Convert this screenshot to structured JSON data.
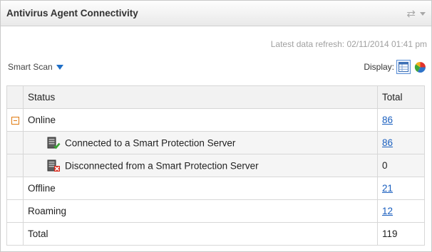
{
  "widget": {
    "title": "Antivirus Agent Connectivity",
    "refresh_text": "Latest data refresh: 02/11/2014 01:41 pm",
    "scan_select": "Smart Scan",
    "display_label": "Display:",
    "icons": {
      "refresh": "refresh-icon",
      "menu": "chevron-down-icon",
      "table_view": "table-icon",
      "chart_view": "pie-chart-icon",
      "connected": "server-connected-icon",
      "disconnected": "server-disconnected-icon"
    }
  },
  "table": {
    "headers": {
      "status": "Status",
      "total": "Total"
    },
    "rows": [
      {
        "status": "Online",
        "total": "86",
        "link": true
      },
      {
        "status": "Connected to a Smart Protection Server",
        "total": "86",
        "link": true
      },
      {
        "status": "Disconnected from a Smart Protection Server",
        "total": "0",
        "link": false
      },
      {
        "status": "Offline",
        "total": "21",
        "link": true
      },
      {
        "status": "Roaming",
        "total": "12",
        "link": true
      },
      {
        "status": "Total",
        "total": "119",
        "link": false
      }
    ]
  },
  "colors": {
    "link": "#1a5fbf",
    "collapse": "#e07a10",
    "connected": "#3aa335",
    "disconnected": "#d92a1c"
  }
}
